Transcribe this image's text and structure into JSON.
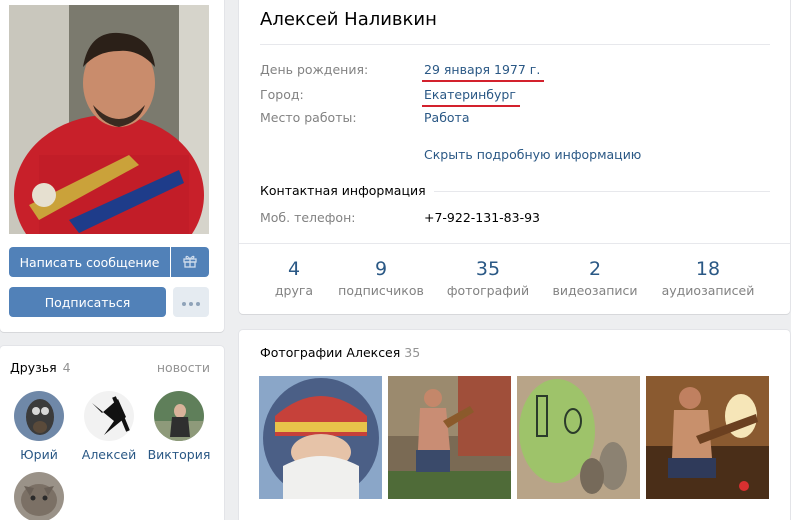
{
  "profile": {
    "name": "Алексей Наливкин",
    "rows": [
      {
        "label": "День рождения:",
        "value": "29 января 1977 г."
      },
      {
        "label": "Город:",
        "value": "Екатеринбург"
      },
      {
        "label": "Место работы:",
        "value": "Работа"
      }
    ],
    "hide_link": "Скрыть подробную информацию",
    "contact_title": "Контактная информация",
    "phone_label": "Моб. телефон:",
    "phone_value": "+7-922-131-83-93"
  },
  "actions": {
    "message": "Написать сообщение",
    "subscribe": "Подписаться",
    "gift_icon": "gift-icon",
    "more_icon": "more-dots-icon"
  },
  "stats": [
    {
      "num": "4",
      "cap": "друга"
    },
    {
      "num": "9",
      "cap": "подписчиков"
    },
    {
      "num": "35",
      "cap": "фотографий"
    },
    {
      "num": "2",
      "cap": "видеозаписи"
    },
    {
      "num": "18",
      "cap": "аудиозаписей"
    }
  ],
  "friends": {
    "title": "Друзья",
    "count": "4",
    "news": "новости",
    "items": [
      {
        "name": "Юрий"
      },
      {
        "name": "Алексей"
      },
      {
        "name": "Виктория"
      }
    ]
  },
  "photos": {
    "title": "Фотографии Алексея",
    "count": "35"
  },
  "colors": {
    "link": "#2a5885",
    "button_primary": "#5181b8",
    "underline_red": "#d3212d",
    "background": "#edeef0"
  }
}
